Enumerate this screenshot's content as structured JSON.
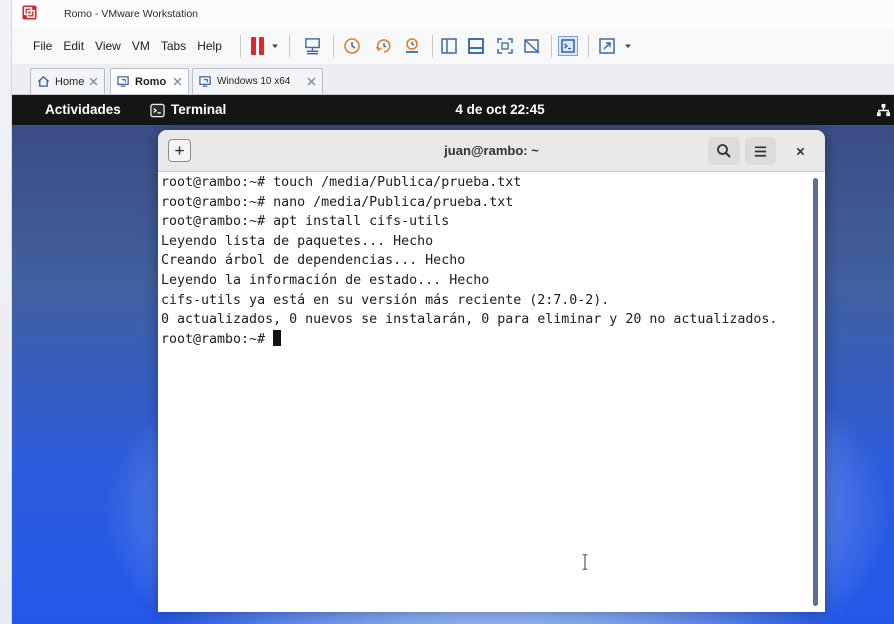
{
  "window": {
    "title": "Romo - VMware Workstation",
    "app_icon": "vmware-icon"
  },
  "menu": {
    "items": [
      "File",
      "Edit",
      "View",
      "VM",
      "Tabs",
      "Help"
    ]
  },
  "toolbar": {
    "icons": [
      "pause-icon",
      "dropdown-caret-icon",
      "send-ctrl-alt-del-icon",
      "take-snapshot-icon",
      "revert-snapshot-icon",
      "manage-snapshots-icon",
      "library-view-icon",
      "thumbnail-bar-icon",
      "fit-guest-icon",
      "unity-icon",
      "console-view-icon",
      "full-screen-icon",
      "dropdown-caret-icon"
    ]
  },
  "tabs": [
    {
      "label": "Home",
      "icon": "home-icon",
      "active": false
    },
    {
      "label": "Romo",
      "icon": "vm-icon",
      "active": true
    },
    {
      "label": "Windows 10 x64",
      "icon": "vm-icon",
      "active": false
    }
  ],
  "guest": {
    "topbar": {
      "activities": "Actividades",
      "app_label": "Terminal",
      "clock": "4 de oct 22:45",
      "status_icon": "network-icon"
    },
    "terminal": {
      "title": "juan@rambo: ~",
      "lines": [
        "root@rambo:~# touch /media/Publica/prueba.txt",
        "root@rambo:~# nano /media/Publica/prueba.txt",
        "root@rambo:~# apt install cifs-utils",
        "Leyendo lista de paquetes... Hecho",
        "Creando árbol de dependencias... Hecho",
        "Leyendo la información de estado... Hecho",
        "cifs-utils ya está en su versión más reciente (2:7.0-2).",
        "0 actualizados, 0 nuevos se instalarán, 0 para eliminar y 20 no actualizados.",
        "root@rambo:~# "
      ]
    }
  },
  "colors": {
    "vmware_red": "#d8262c",
    "pause_red": "#e0262b",
    "toolbar_icon": "#3b6aa6",
    "snapshot_orange": "#d9822b",
    "gnome_topbar": "#151515",
    "terminal_header": "#e9e9e9",
    "terminal_bg": "#ffffff",
    "terminal_text": "#202020",
    "wallpaper_blue": "#2357ea"
  }
}
